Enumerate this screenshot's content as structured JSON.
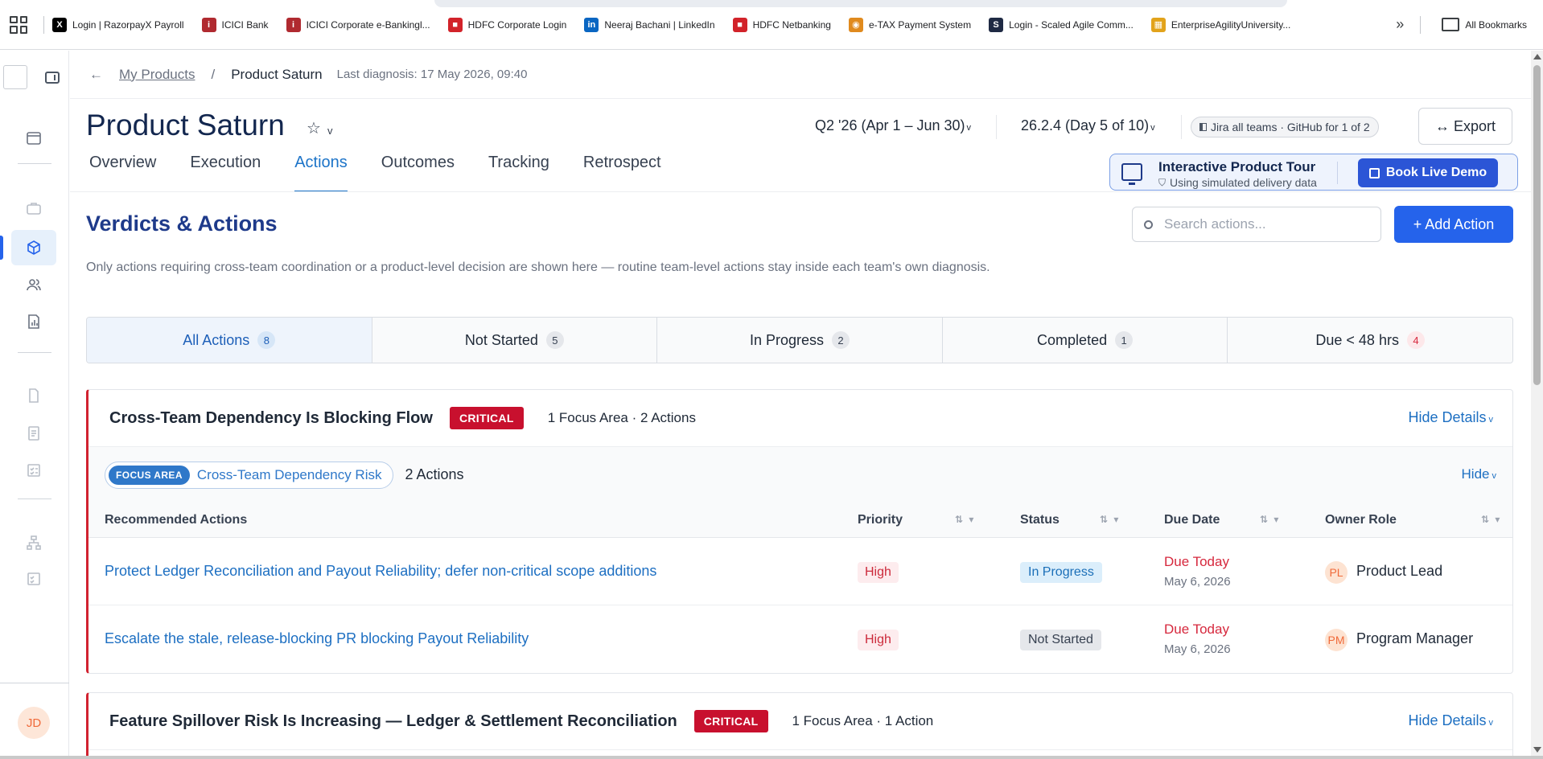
{
  "bookmarks": [
    {
      "label": "Login | RazorpayX Payroll",
      "icon": "x-logo-icon",
      "color": "#000000",
      "glyph": "X"
    },
    {
      "label": "ICICI Bank",
      "icon": "icici-logo-icon",
      "color": "#b02a30",
      "glyph": "i"
    },
    {
      "label": "ICICI Corporate e-Bankingl...",
      "icon": "icici-logo-icon",
      "color": "#b02a30",
      "glyph": "i"
    },
    {
      "label": "HDFC Corporate Login",
      "icon": "hdfc-logo-icon",
      "color": "#d2232a",
      "glyph": "■"
    },
    {
      "label": "Neeraj Bachani | LinkedIn",
      "icon": "linkedin-logo-icon",
      "color": "#0a66c2",
      "glyph": "in"
    },
    {
      "label": "HDFC Netbanking",
      "icon": "hdfc-logo-icon",
      "color": "#d2232a",
      "glyph": "■"
    },
    {
      "label": "e-TAX Payment System",
      "icon": "etax-logo-icon",
      "color": "#e08a1e",
      "glyph": "◉"
    },
    {
      "label": "Login - Scaled Agile Comm...",
      "icon": "scaled-agile-logo-icon",
      "color": "#1f2a44",
      "glyph": "S"
    },
    {
      "label": "EnterpriseAgilityUniversity...",
      "icon": "eau-logo-icon",
      "color": "#e2a31b",
      "glyph": "▦"
    }
  ],
  "bookmarks_more": "»",
  "all_bookmarks": "All Bookmarks",
  "breadcrumb": {
    "back": "←",
    "parent": "My Products",
    "separator": "/",
    "current": "Product Saturn",
    "last_diagnosis": "Last diagnosis: 17 May 2026, 09:40"
  },
  "product": {
    "title": "Product Saturn",
    "star": "☆",
    "chevron": "v"
  },
  "header": {
    "quarter": "Q2 '26 (Apr 1 – Jun 30)",
    "release": "26.2.4 (Day 5 of 10)",
    "chev": "v",
    "source": "Jira all teams · GitHub for 1 of 2",
    "export": "↔ Export"
  },
  "tabs": [
    {
      "label": "Overview",
      "active": false
    },
    {
      "label": "Execution",
      "active": false
    },
    {
      "label": "Actions",
      "active": true
    },
    {
      "label": "Outcomes",
      "active": false
    },
    {
      "label": "Tracking",
      "active": false
    },
    {
      "label": "Retrospect",
      "active": false
    }
  ],
  "tour": {
    "title": "Interactive Product Tour",
    "subtitle": "Using simulated delivery data",
    "button": "Book Live Demo"
  },
  "section": {
    "title": "Verdicts & Actions",
    "search_placeholder": "Search actions...",
    "add_button": "+ Add Action",
    "description": "Only actions requiring cross-team coordination or a product-level decision are shown here — routine team-level actions stay inside each team's own diagnosis."
  },
  "filters": [
    {
      "label": "All Actions",
      "count": "8",
      "active": true
    },
    {
      "label": "Not Started",
      "count": "5",
      "active": false
    },
    {
      "label": "In Progress",
      "count": "2",
      "active": false
    },
    {
      "label": "Completed",
      "count": "1",
      "active": false
    },
    {
      "label": "Due < 48 hrs",
      "count": "4",
      "active": false,
      "alert": true
    }
  ],
  "columns": {
    "action": "Recommended Actions",
    "priority": "Priority",
    "status": "Status",
    "due": "Due Date",
    "owner": "Owner Role",
    "sort": "⇅ ▾"
  },
  "verdicts": [
    {
      "title": "Cross-Team Dependency Is Blocking Flow",
      "severity": "CRITICAL",
      "meta": "1 Focus Area · 2 Actions",
      "toggle": "Hide Details",
      "focus_area": {
        "tag": "FOCUS AREA",
        "name": "Cross-Team Dependency Risk",
        "count": "2 Actions",
        "toggle": "Hide"
      },
      "actions": [
        {
          "title": "Protect Ledger Reconciliation and Payout Reliability; defer non-critical scope additions",
          "priority": "High",
          "status": "In Progress",
          "due_label": "Due Today",
          "due_date": "May 6, 2026",
          "owner_initials": "PL",
          "owner": "Product Lead"
        },
        {
          "title": "Escalate the stale, release-blocking PR blocking Payout Reliability",
          "priority": "High",
          "status": "Not Started",
          "due_label": "Due Today",
          "due_date": "May 6, 2026",
          "owner_initials": "PM",
          "owner": "Program Manager"
        }
      ]
    },
    {
      "title": "Feature Spillover Risk Is Increasing — Ledger & Settlement Reconciliation",
      "severity": "CRITICAL",
      "meta": "1 Focus Area · 1 Action",
      "toggle": "Hide Details"
    }
  ],
  "user": {
    "initials": "JD"
  },
  "colors": {
    "accent": "#2563eb",
    "critical": "#c8102e",
    "link": "#1d6fc2"
  }
}
